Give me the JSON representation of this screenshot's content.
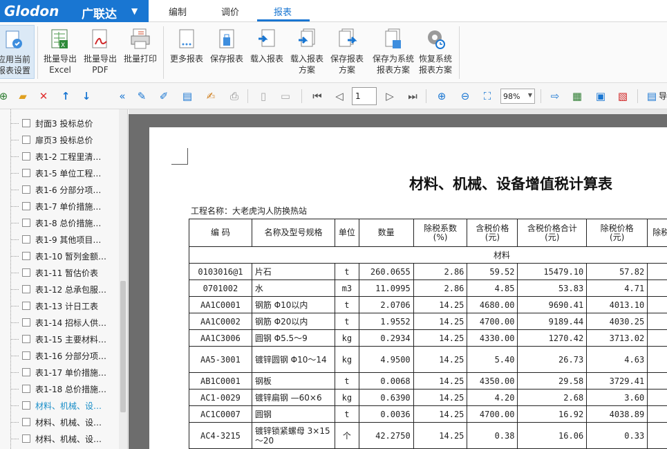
{
  "app": {
    "logo_text": "Glodon",
    "logo_cn": "广联达",
    "tabs": [
      "编制",
      "调价",
      "报表"
    ],
    "active_tab": "报表"
  },
  "ribbon": [
    {
      "id": "apply",
      "line1": "应用当前",
      "line2": "报表设置",
      "icon": "apply-settings-icon",
      "selected": true
    },
    {
      "id": "excel",
      "line1": "批量导出",
      "line2": "Excel",
      "icon": "excel-export-icon"
    },
    {
      "id": "pdf",
      "line1": "批量导出",
      "line2": "PDF",
      "icon": "pdf-export-icon"
    },
    {
      "id": "print",
      "line1": "批量打印",
      "line2": "",
      "icon": "print-icon"
    },
    {
      "id": "more",
      "line1": "更多报表",
      "line2": "",
      "icon": "more-reports-icon"
    },
    {
      "id": "save",
      "line1": "保存报表",
      "line2": "",
      "icon": "save-report-icon"
    },
    {
      "id": "load",
      "line1": "载入报表",
      "line2": "",
      "icon": "load-report-icon"
    },
    {
      "id": "loadscheme",
      "line1": "载入报表",
      "line2": "方案",
      "icon": "load-scheme-icon"
    },
    {
      "id": "savescheme",
      "line1": "保存报表",
      "line2": "方案",
      "icon": "save-scheme-icon"
    },
    {
      "id": "savesys",
      "line1": "保存为系统",
      "line2": "报表方案",
      "icon": "save-system-icon"
    },
    {
      "id": "restore",
      "line1": "恢复系统",
      "line2": "报表方案",
      "icon": "restore-system-icon"
    }
  ],
  "toolbar": {
    "page": "1",
    "zoom": "98%",
    "export_label": "导"
  },
  "tree": [
    "封面3 投标总价",
    "扉页3 投标总价",
    "表1-2 工程里清…",
    "表1-5 单位工程…",
    "表1-6 分部分项…",
    "表1-7 单价措施…",
    "表1-8 总价措施…",
    "表1-9 其他项目…",
    "表1-10 暂列金额…",
    "表1-11 暂估价表",
    "表1-12 总承包服…",
    "表1-13 计日工表",
    "表1-14 招标人供…",
    "表1-15 主要材料…",
    "表1-16 分部分项…",
    "表1-17 单价措施…",
    "表1-18 总价措施…",
    "材料、机械、设…",
    "材料、机械、设…",
    "材料、机械、设…"
  ],
  "tree_selected": 17,
  "report": {
    "title": "材料、机械、设备增值税计算表",
    "project": "工程名称：大老虎沟人防换热站",
    "headers": [
      "编  码",
      "名称及型号规格",
      "单位",
      "数量",
      "除税系数\n(%)",
      "含税价格\n(元)",
      "含税价格合计\n(元)",
      "除税价格\n(元)",
      "除税"
    ],
    "section": "材料",
    "rows": [
      [
        "0103016@1",
        "片石",
        "t",
        "260.0655",
        "2.86",
        "59.52",
        "15479.10",
        "57.82"
      ],
      [
        "0701002",
        "水",
        "m3",
        "11.0995",
        "2.86",
        "4.85",
        "53.83",
        "4.71"
      ],
      [
        "AA1C0001",
        "钢筋 Φ10以内",
        "t",
        "2.0706",
        "14.25",
        "4680.00",
        "9690.41",
        "4013.10"
      ],
      [
        "AA1C0002",
        "钢筋 Φ20以内",
        "t",
        "1.9552",
        "14.25",
        "4700.00",
        "9189.44",
        "4030.25"
      ],
      [
        "AA1C3006",
        "圆钢 Φ5.5～9",
        "kg",
        "0.2934",
        "14.25",
        "4330.00",
        "1270.42",
        "3713.02"
      ],
      [
        "AA5-3001",
        "镀锌圆钢 Φ10～14",
        "kg",
        "4.9500",
        "14.25",
        "5.40",
        "26.73",
        "4.63"
      ],
      [
        "AB1C0001",
        "钢板",
        "t",
        "0.0068",
        "14.25",
        "4350.00",
        "29.58",
        "3729.41"
      ],
      [
        "AC1-0029",
        "镀锌扁钢 —60×6",
        "kg",
        "0.6390",
        "14.25",
        "4.20",
        "2.68",
        "3.60"
      ],
      [
        "AC1C0007",
        "圆钢",
        "t",
        "0.0036",
        "14.25",
        "4700.00",
        "16.92",
        "4038.89"
      ],
      [
        "AC4-3215",
        "镀锌锁紧螺母 3×15～20",
        "个",
        "42.2750",
        "14.25",
        "0.38",
        "16.06",
        "0.33"
      ]
    ]
  },
  "colors": {
    "brand": "#1976d2",
    "selected_tree": "#1a8ec8",
    "preview_bg": "#6d6d6d"
  }
}
